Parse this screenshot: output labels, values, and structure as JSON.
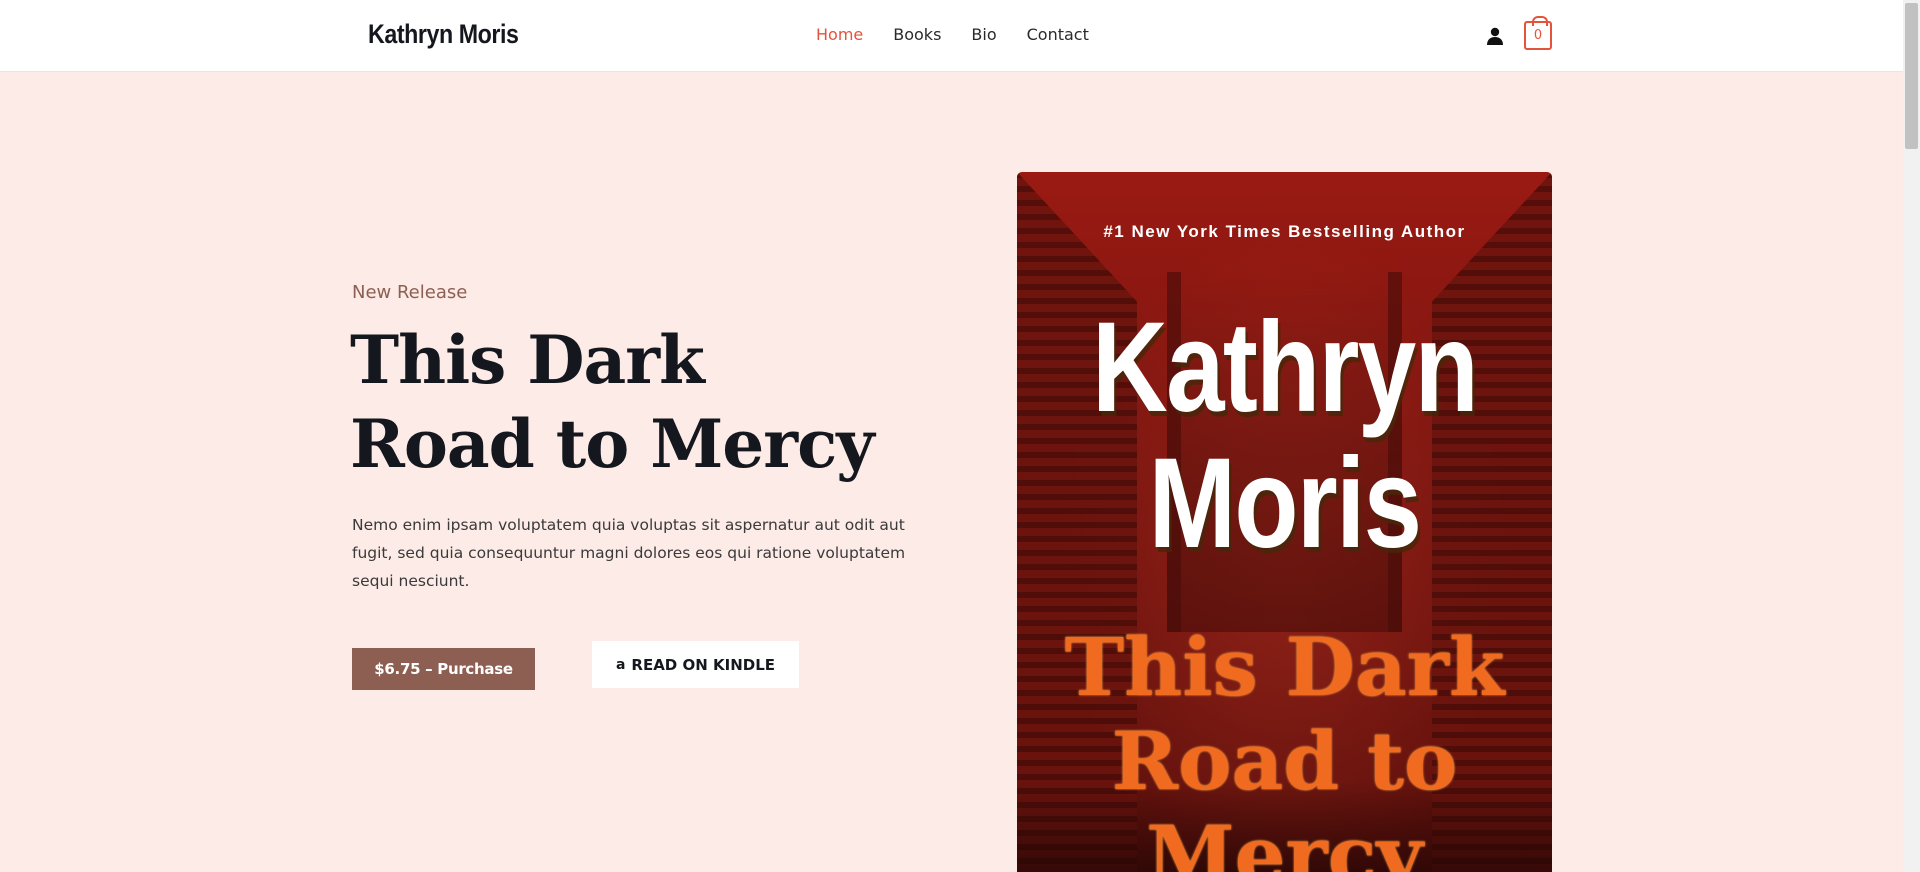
{
  "header": {
    "logo": "Kathryn Moris",
    "nav": [
      {
        "label": "Home",
        "active": true
      },
      {
        "label": "Books",
        "active": false
      },
      {
        "label": "Bio",
        "active": false
      },
      {
        "label": "Contact",
        "active": false
      }
    ],
    "account_icon": "user-icon",
    "cart_icon": "shopping-bag-icon",
    "cart_count": "0"
  },
  "hero": {
    "eyebrow": "New Release",
    "title_line1": "This Dark",
    "title_line2": "Road to Mercy",
    "description": "Nemo enim ipsam voluptatem quia voluptas sit aspernatur aut odit aut fugit, sed quia consequuntur magni dolores eos qui ratione voluptatem sequi nesciunt.",
    "purchase_label": "$6.75 – Purchase",
    "kindle_label": "READ ON KINDLE",
    "kindle_icon": "amazon-icon"
  },
  "cover": {
    "tagline": "#1 New York Times Bestselling Author",
    "author_line1": "Kathryn",
    "author_line2": "Moris",
    "title_line1": "This Dark",
    "title_line2": "Road to",
    "title_line3": "Mercy"
  },
  "colors": {
    "accent": "#e4533b",
    "background": "#fcebe6",
    "button": "#8d5f52",
    "text": "#15171e"
  }
}
